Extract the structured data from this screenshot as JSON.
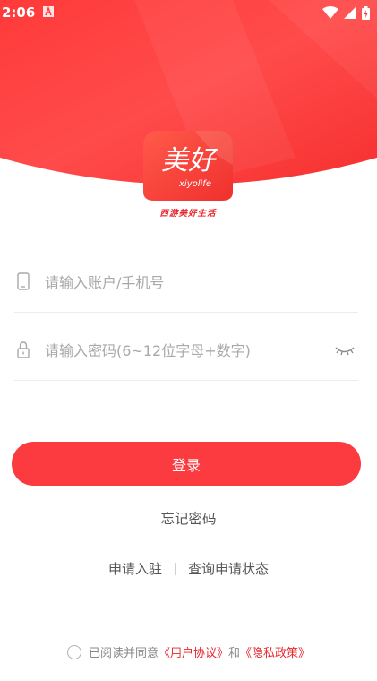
{
  "status": {
    "time": "2:06"
  },
  "brand": {
    "logo_main": "美好",
    "logo_sub": "xiyolife",
    "slogan": "西游美好生活"
  },
  "form": {
    "account_placeholder": "请输入账户/手机号",
    "password_placeholder": "请输入密码(6~12位字母+数字)"
  },
  "actions": {
    "login_label": "登录",
    "forgot_label": "忘记密码",
    "apply_label": "申请入驻",
    "query_label": "查询申请状态"
  },
  "agreement": {
    "prefix": "已阅读并同意",
    "user_agreement": "《用户协议》",
    "and": "和",
    "privacy_policy": "《隐私政策》"
  },
  "colors": {
    "brand_red": "#fb3b3f",
    "link_red": "#e8262c"
  }
}
